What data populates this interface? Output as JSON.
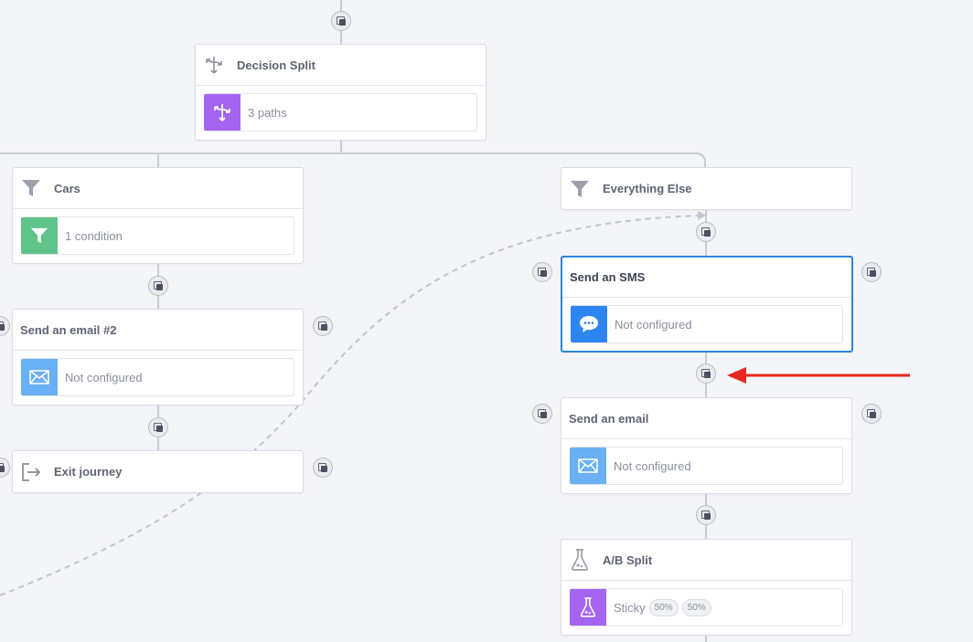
{
  "journey": {
    "decision_split": {
      "title": "Decision Split",
      "paths": "3 paths"
    },
    "cars_branch": {
      "title": "Cars",
      "condition": "1 condition"
    },
    "send_email_2": {
      "title": "Send an email #2",
      "status": "Not configured"
    },
    "exit_journey": {
      "title": "Exit journey"
    },
    "everything_else": {
      "title": "Everything Else"
    },
    "send_sms": {
      "title": "Send an SMS",
      "status": "Not configured"
    },
    "send_email": {
      "title": "Send an email",
      "status": "Not configured"
    },
    "ab_split": {
      "title": "A/B Split",
      "label": "Sticky",
      "split_a": "50%",
      "split_b": "50%"
    }
  },
  "colors": {
    "canvas": "#f4f5f9",
    "selected_border": "#2d86d9",
    "split_purple": "#a464f0",
    "filter_green": "#5ec48a",
    "sms_blue": "#2d86f0",
    "email_blue": "#6ab0f5",
    "arrow_red": "#e8281e"
  },
  "icons": {
    "decision": "branch-arrows-icon",
    "filter": "funnel-icon",
    "sms": "chat-bubble-icon",
    "email": "envelope-icon",
    "exit": "exit-door-icon",
    "ab": "flask-icon",
    "add": "add-step-icon"
  }
}
